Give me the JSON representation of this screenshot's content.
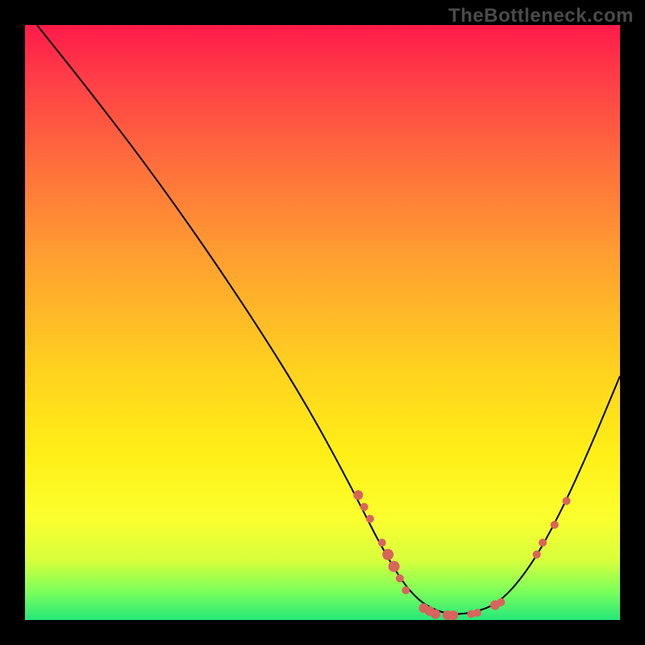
{
  "watermark": "TheBottleneck.com",
  "chart_data": {
    "type": "line",
    "title": "",
    "xlabel": "",
    "ylabel": "",
    "xlim": [
      0,
      100
    ],
    "ylim": [
      0,
      100
    ],
    "curve_points": [
      {
        "x": 2,
        "y": 100
      },
      {
        "x": 10,
        "y": 90
      },
      {
        "x": 20,
        "y": 77
      },
      {
        "x": 30,
        "y": 63
      },
      {
        "x": 40,
        "y": 48
      },
      {
        "x": 48,
        "y": 35
      },
      {
        "x": 55,
        "y": 22
      },
      {
        "x": 60,
        "y": 12
      },
      {
        "x": 65,
        "y": 4
      },
      {
        "x": 70,
        "y": 1
      },
      {
        "x": 75,
        "y": 1
      },
      {
        "x": 80,
        "y": 3
      },
      {
        "x": 85,
        "y": 9
      },
      {
        "x": 90,
        "y": 18
      },
      {
        "x": 95,
        "y": 29
      },
      {
        "x": 100,
        "y": 41
      }
    ],
    "dots": [
      {
        "x": 56,
        "y": 21,
        "r": 6
      },
      {
        "x": 57,
        "y": 19,
        "r": 5
      },
      {
        "x": 58,
        "y": 17,
        "r": 5
      },
      {
        "x": 60,
        "y": 13,
        "r": 5
      },
      {
        "x": 61,
        "y": 11,
        "r": 7
      },
      {
        "x": 62,
        "y": 9,
        "r": 7
      },
      {
        "x": 63,
        "y": 7,
        "r": 5
      },
      {
        "x": 64,
        "y": 5,
        "r": 5
      },
      {
        "x": 67,
        "y": 2,
        "r": 6
      },
      {
        "x": 68,
        "y": 1.5,
        "r": 6
      },
      {
        "x": 69,
        "y": 1,
        "r": 6
      },
      {
        "x": 71,
        "y": 0.8,
        "r": 6
      },
      {
        "x": 72,
        "y": 0.8,
        "r": 6
      },
      {
        "x": 75,
        "y": 1,
        "r": 5
      },
      {
        "x": 76,
        "y": 1.2,
        "r": 5
      },
      {
        "x": 79,
        "y": 2.5,
        "r": 6
      },
      {
        "x": 80,
        "y": 3,
        "r": 5
      },
      {
        "x": 86,
        "y": 11,
        "r": 5
      },
      {
        "x": 87,
        "y": 13,
        "r": 5
      },
      {
        "x": 89,
        "y": 16,
        "r": 5
      },
      {
        "x": 91,
        "y": 20,
        "r": 5
      }
    ]
  }
}
